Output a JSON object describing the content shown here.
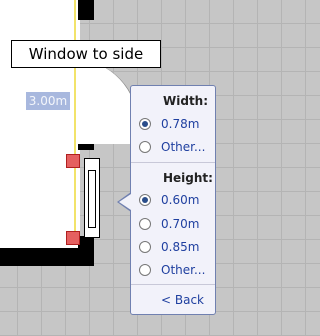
{
  "canvas": {
    "tooltip_text": "Window to side",
    "dimension_label": "3.00m"
  },
  "popup": {
    "width_section": {
      "title": "Width:",
      "options": [
        "0.78m",
        "Other..."
      ],
      "selected": "0.78m"
    },
    "height_section": {
      "title": "Height:",
      "options": [
        "0.60m",
        "0.70m",
        "0.85m",
        "Other..."
      ],
      "selected": "0.60m"
    },
    "back_label": "< Back"
  },
  "colors": {
    "accent": "#2a4d8a",
    "handle": "#e56060",
    "dimension_bg": "#a8b8de"
  }
}
